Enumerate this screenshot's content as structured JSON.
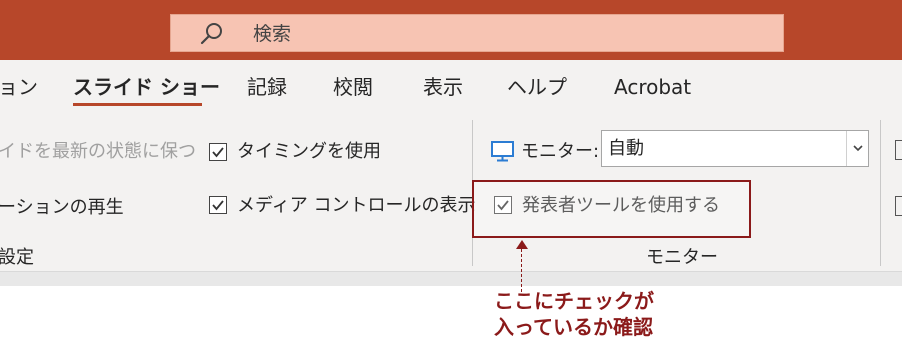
{
  "search": {
    "placeholder_text": "検索"
  },
  "tabs": [
    {
      "label": "ョン"
    },
    {
      "label": "スライド ショー",
      "active": true
    },
    {
      "label": "記録"
    },
    {
      "label": "校閲"
    },
    {
      "label": "表示"
    },
    {
      "label": "ヘルプ"
    },
    {
      "label": "Acrobat"
    }
  ],
  "ribbon": {
    "setup_group": {
      "keep_updated_label": "イドを最新の状態に保つ",
      "narration_label": "ーションの再生",
      "group_label": "設定",
      "use_timings_label": "タイミングを使用",
      "use_timings_checked": true,
      "media_controls_label": "メディア コントロールの表示",
      "media_controls_checked": true
    },
    "monitor_group": {
      "monitor_label": "モニター:",
      "monitor_value": "自動",
      "presenter_view_label": "発表者ツールを使用する",
      "presenter_view_checked": true,
      "group_label": "モニター"
    }
  },
  "annotation": {
    "line1": "ここにチェックが",
    "line2": "入っているか確認"
  },
  "colors": {
    "title_bar": "#b7472a",
    "search_box": "#f7c4b3",
    "ribbon_bg": "#f3f2f1",
    "annotation": "#8b1a1a",
    "monitor_icon": "#2b7cd3"
  }
}
